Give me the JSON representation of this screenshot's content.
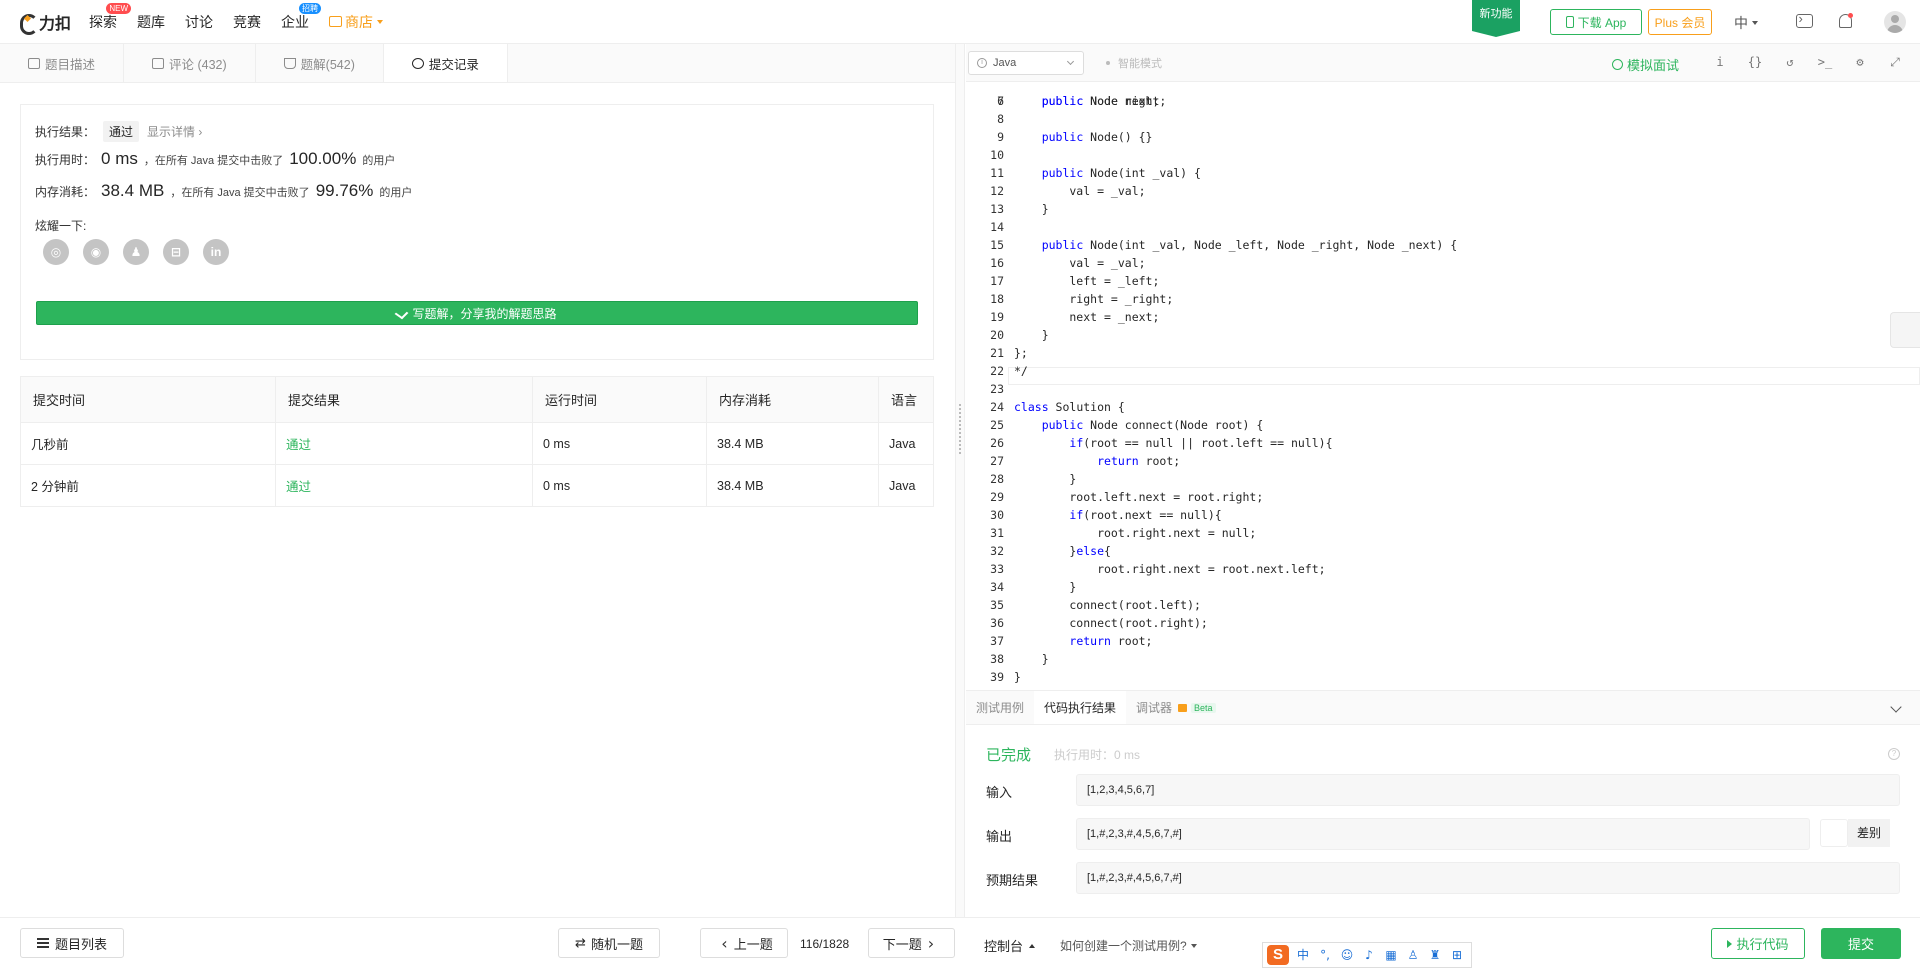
{
  "topnav": {
    "logo": "力扣",
    "items": [
      {
        "label": "探索",
        "badge": "NEW"
      },
      {
        "label": "题库"
      },
      {
        "label": "讨论"
      },
      {
        "label": "竞赛"
      },
      {
        "label": "企业",
        "badge": "招聘"
      }
    ],
    "shop": "商店",
    "new_feature": "新功能",
    "download_app": "下载 App",
    "plus": "Plus 会员",
    "lang": "中"
  },
  "left_tabs": [
    "题目描述",
    "评论 (432)",
    "题解(542)",
    "提交记录"
  ],
  "result": {
    "status_label": "执行结果：",
    "status_value": "通过",
    "details_link": "显示详情 ›",
    "time_label": "执行用时：",
    "time_value": "0 ms",
    "time_text": "，在所有 Java 提交中击败了",
    "time_percent": "100.00%",
    "users": "的用户",
    "mem_label": "内存消耗：",
    "mem_value": "38.4 MB",
    "mem_text": "，在所有 Java 提交中击败了",
    "mem_percent": "99.76%",
    "share_label": "炫耀一下:",
    "share_icons": [
      "wechat-icon",
      "weibo-icon",
      "qq-icon",
      "douban-icon",
      "linkedin-icon"
    ],
    "write_solution": "写题解，分享我的解题思路"
  },
  "submissions": {
    "headers": [
      "提交时间",
      "提交结果",
      "运行时间",
      "内存消耗",
      "语言"
    ],
    "rows": [
      {
        "time": "几秒前",
        "result": "通过",
        "runtime": "0 ms",
        "memory": "38.4 MB",
        "lang": "Java"
      },
      {
        "time": "2 分钟前",
        "result": "通过",
        "runtime": "0 ms",
        "memory": "38.4 MB",
        "lang": "Java"
      }
    ]
  },
  "editor": {
    "language": "Java",
    "smart_mode": "智能模式",
    "mock_interview": "模拟面试",
    "lines": [
      {
        "n": "7",
        "t": "    public Node next;"
      },
      {
        "n": "8",
        "t": ""
      },
      {
        "n": "9",
        "t": "    public Node() {}"
      },
      {
        "n": "10",
        "t": ""
      },
      {
        "n": "11",
        "t": "    public Node(int _val) {"
      },
      {
        "n": "12",
        "t": "        val = _val;"
      },
      {
        "n": "13",
        "t": "    }"
      },
      {
        "n": "14",
        "t": ""
      },
      {
        "n": "15",
        "t": "    public Node(int _val, Node _left, Node _right, Node _next) {"
      },
      {
        "n": "16",
        "t": "        val = _val;"
      },
      {
        "n": "17",
        "t": "        left = _left;"
      },
      {
        "n": "18",
        "t": "        right = _right;"
      },
      {
        "n": "19",
        "t": "        next = _next;"
      },
      {
        "n": "20",
        "t": "    }"
      },
      {
        "n": "21",
        "t": "};"
      },
      {
        "n": "22",
        "t": "*/"
      },
      {
        "n": "23",
        "t": ""
      },
      {
        "n": "24",
        "t": "class Solution {"
      },
      {
        "n": "25",
        "t": "    public Node connect(Node root) {"
      },
      {
        "n": "26",
        "t": "        if(root == null || root.left == null){"
      },
      {
        "n": "27",
        "t": "            return root;"
      },
      {
        "n": "28",
        "t": "        }"
      },
      {
        "n": "29",
        "t": "        root.left.next = root.right;"
      },
      {
        "n": "30",
        "t": "        if(root.next == null){"
      },
      {
        "n": "31",
        "t": "            root.right.next = null;"
      },
      {
        "n": "32",
        "t": "        }else{"
      },
      {
        "n": "33",
        "t": "            root.right.next = root.next.left;"
      },
      {
        "n": "34",
        "t": "        }"
      },
      {
        "n": "35",
        "t": "        connect(root.left);"
      },
      {
        "n": "36",
        "t": "        connect(root.right);"
      },
      {
        "n": "37",
        "t": "        return root;"
      },
      {
        "n": "38",
        "t": "    }"
      },
      {
        "n": "39",
        "t": "}"
      }
    ]
  },
  "console": {
    "tabs": [
      "测试用例",
      "代码执行结果",
      "调试器"
    ],
    "beta": "Beta",
    "status": "已完成",
    "exec_time": "执行用时：0 ms",
    "input_label": "输入",
    "input_value": "[1,2,3,4,5,6,7]",
    "output_label": "输出",
    "output_value": "[1,#,2,3,#,4,5,6,7,#]",
    "expected_label": "预期结果",
    "expected_value": "[1,#,2,3,#,4,5,6,7,#]",
    "diff": "差别"
  },
  "bottombar": {
    "problem_list": "题目列表",
    "random": "随机一题",
    "prev": "上一题",
    "page": "116/1828",
    "next": "下一题",
    "console": "控制台",
    "howto": "如何创建一个测试用例?",
    "ime_label": "中",
    "run": "执行代码",
    "submit": "提交"
  },
  "colors": {
    "accent": "#2db55d",
    "orange": "#f89f1b",
    "keyword": "#0000ff"
  }
}
